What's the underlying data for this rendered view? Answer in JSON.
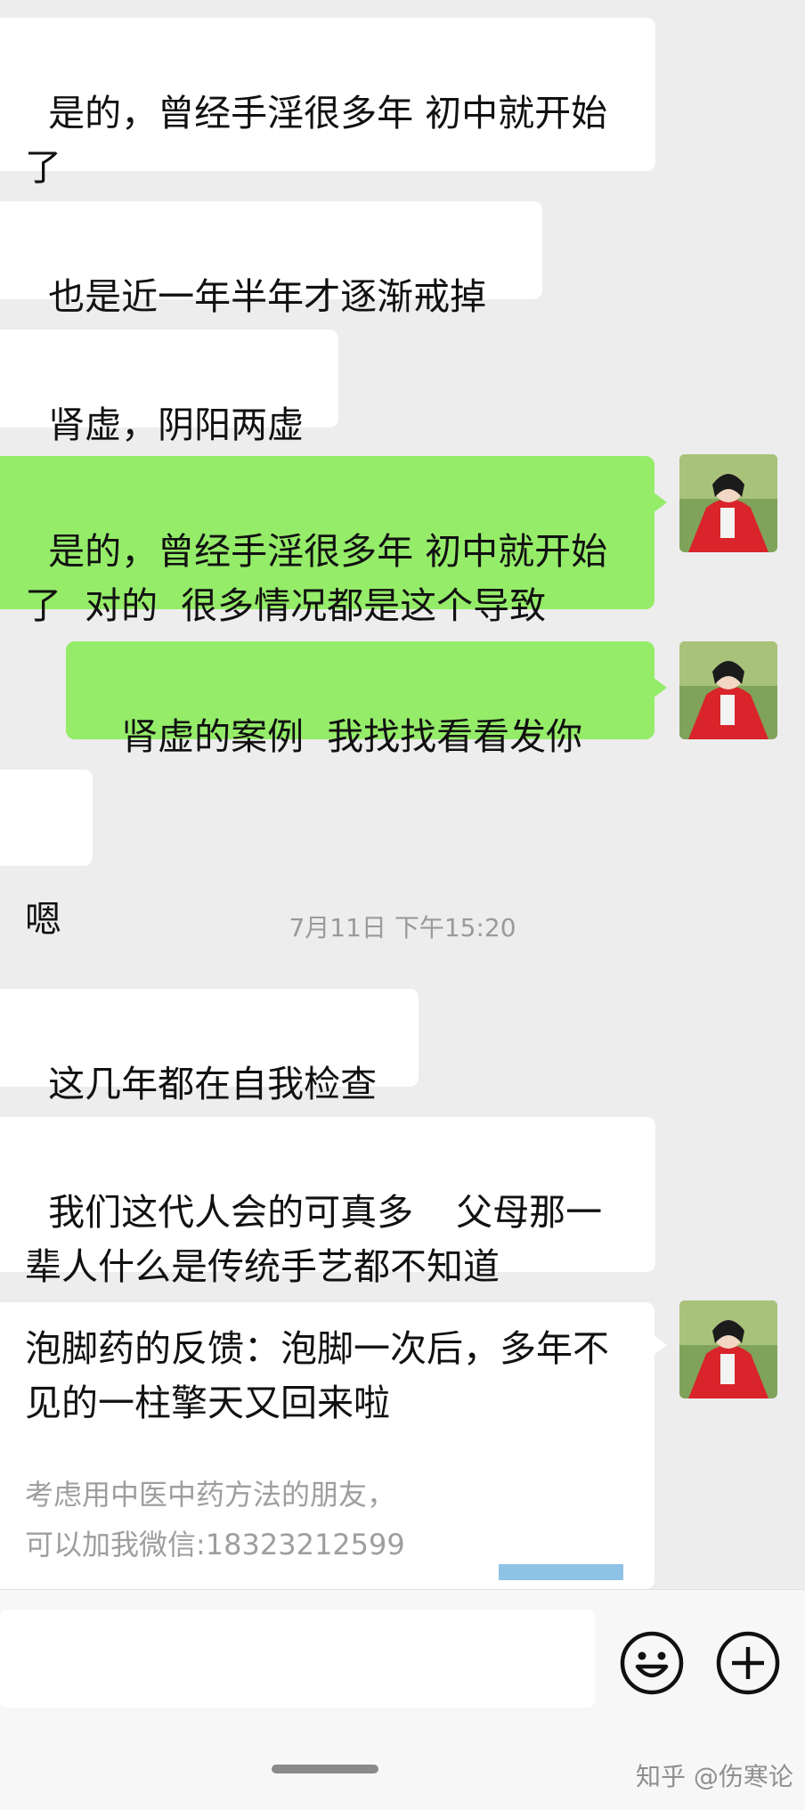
{
  "messages": {
    "m1": "是的，曾经手淫很多年 初中就开始了",
    "m2": "也是近一年半年才逐渐戒掉",
    "m3": "肾虚，阴阳两虚",
    "m4": "是的，曾经手淫很多年 初中就开始了  对的  很多情况都是这个导致",
    "m5": "肾虚的案例  我找找看看发你",
    "m6": "嗯",
    "m7": "这几年都在自我检查",
    "m8_part1": "我们这代人会的可真多",
    "m8_part2": "父母那一辈人什么是传统手艺都不知道"
  },
  "timestamp": "7月11日 下午15:20",
  "card": {
    "main": "泡脚药的反馈：泡脚一次后，多年不见的一柱擎天又回来啦",
    "sub": "考虑用中医中药方法的朋友，\n可以加我微信:18323212599"
  },
  "icons": {
    "emoji_inline": "crying-laughing-emoji",
    "emoji_button": "smiley-face-icon",
    "add_button": "plus-circle-icon"
  },
  "watermark": "知乎 @伤寒论",
  "colors": {
    "background": "#ededed",
    "incoming_bubble": "#ffffff",
    "outgoing_bubble": "#95ec69"
  }
}
